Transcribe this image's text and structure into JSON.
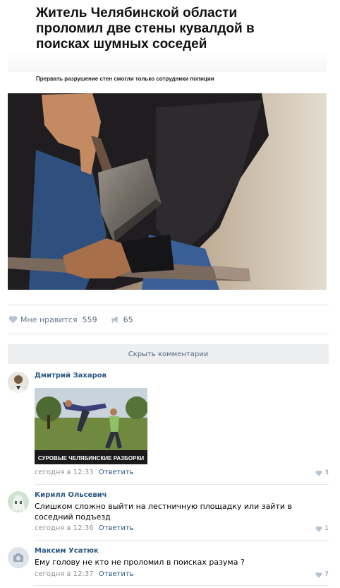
{
  "news": {
    "title": "Житель Челябинской области проломил две стены кувалдой в поисках шумных соседей",
    "subtitle": "Прервать разрушение стен смогли только сотрудники полиции"
  },
  "post_bar": {
    "like_label": "Мне нравится",
    "like_count": "559",
    "share_count": "65"
  },
  "hide_comments_label": "Скрыть комментарии",
  "comments": [
    {
      "author": "Дмитрий Захаров",
      "image_caption": "СУРОВЫЕ ЧЕЛЯБИНСКИЕ РАЗБОРКИ",
      "time": "сегодня в 12:33",
      "reply_label": "Ответить",
      "likes": "3"
    },
    {
      "author": "Кирилл Ольсевич",
      "text": "Слишком сложно выйти на лестничную площадку или зайти в соседний подъезд",
      "time": "сегодня в 12:36",
      "reply_label": "Ответить",
      "likes": "1"
    },
    {
      "author": "Максим Усатюк",
      "text": "Ему голову не кто не проломил в поисках разума ?",
      "time": "сегодня в 12:37",
      "reply_label": "Ответить",
      "likes": "7"
    }
  ],
  "colors": {
    "link": "#2a5885",
    "meta": "#939393",
    "button_bg": "#edeef0",
    "icon": "#b5c3d5"
  }
}
